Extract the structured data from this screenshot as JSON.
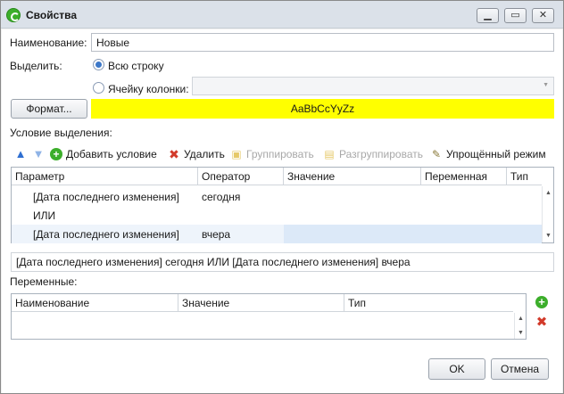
{
  "window": {
    "title": "Свойства",
    "minimize": "▁",
    "maximize": "▭",
    "close": "✕"
  },
  "name": {
    "label": "Наименование:",
    "value": "Новые"
  },
  "highlight": {
    "label": "Выделить:",
    "option_row": "Всю строку",
    "option_cell": "Ячейку колонки:",
    "selected": "row"
  },
  "format": {
    "button": "Формат...",
    "preview": "AaBbCcYyZz",
    "preview_color": "#ffff00"
  },
  "condition": {
    "label": "Условие выделения:",
    "toolbar": {
      "add": "Добавить условие",
      "delete": "Удалить",
      "group": "Группировать",
      "ungroup": "Разгруппировать",
      "simple_mode": "Упрощённый режим"
    },
    "columns": [
      "Параметр",
      "Оператор",
      "Значение",
      "Переменная",
      "Тип"
    ],
    "rows": [
      {
        "param": "[Дата последнего изменения]",
        "operator": "сегодня",
        "value": "",
        "variable": "",
        "type": ""
      },
      {
        "param": "ИЛИ",
        "operator": "",
        "value": "",
        "variable": "",
        "type": ""
      },
      {
        "param": "[Дата последнего изменения]",
        "operator": "вчера",
        "value": "",
        "variable": "",
        "type": ""
      }
    ],
    "expression": "[Дата последнего изменения] сегодня ИЛИ [Дата последнего изменения] вчера"
  },
  "variables": {
    "label": "Переменные:",
    "columns": [
      "Наименование",
      "Значение",
      "Тип"
    ]
  },
  "buttons": {
    "ok": "OK",
    "cancel": "Отмена"
  },
  "colors": {
    "accent": "#3c78c9",
    "selected_row": "#dce9f8",
    "add_green": "#3cae2b",
    "delete_red": "#d23a2a"
  }
}
